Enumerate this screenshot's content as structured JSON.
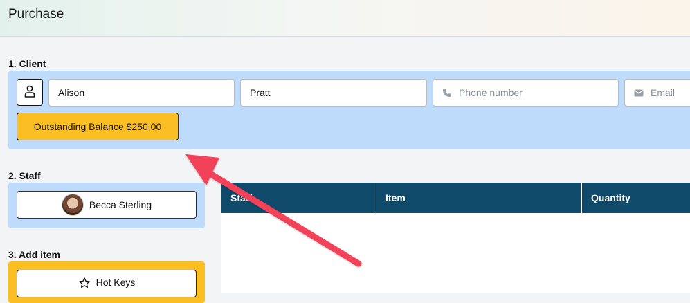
{
  "header": {
    "title": "Purchase"
  },
  "client": {
    "label": "1. Client",
    "profile_icon": "user-icon",
    "first_name": "Alison",
    "last_name": "Pratt",
    "phone_placeholder": "Phone number",
    "phone_icon": "phone-icon",
    "email_placeholder": "Email",
    "email_icon": "envelope-icon",
    "balance_button": "Outstanding Balance $250.00",
    "balance_color": "#fbbf24"
  },
  "staff": {
    "label": "2. Staff",
    "name": "Becca Sterling",
    "avatar": "staff-avatar"
  },
  "add_item": {
    "label": "3. Add item",
    "hotkeys_label": "Hot Keys",
    "hotkeys_icon": "star-icon"
  },
  "table": {
    "columns": [
      "Staff",
      "Item",
      "Quantity"
    ]
  },
  "annotation": {
    "icon": "red-arrow",
    "color": "#f2425a"
  }
}
